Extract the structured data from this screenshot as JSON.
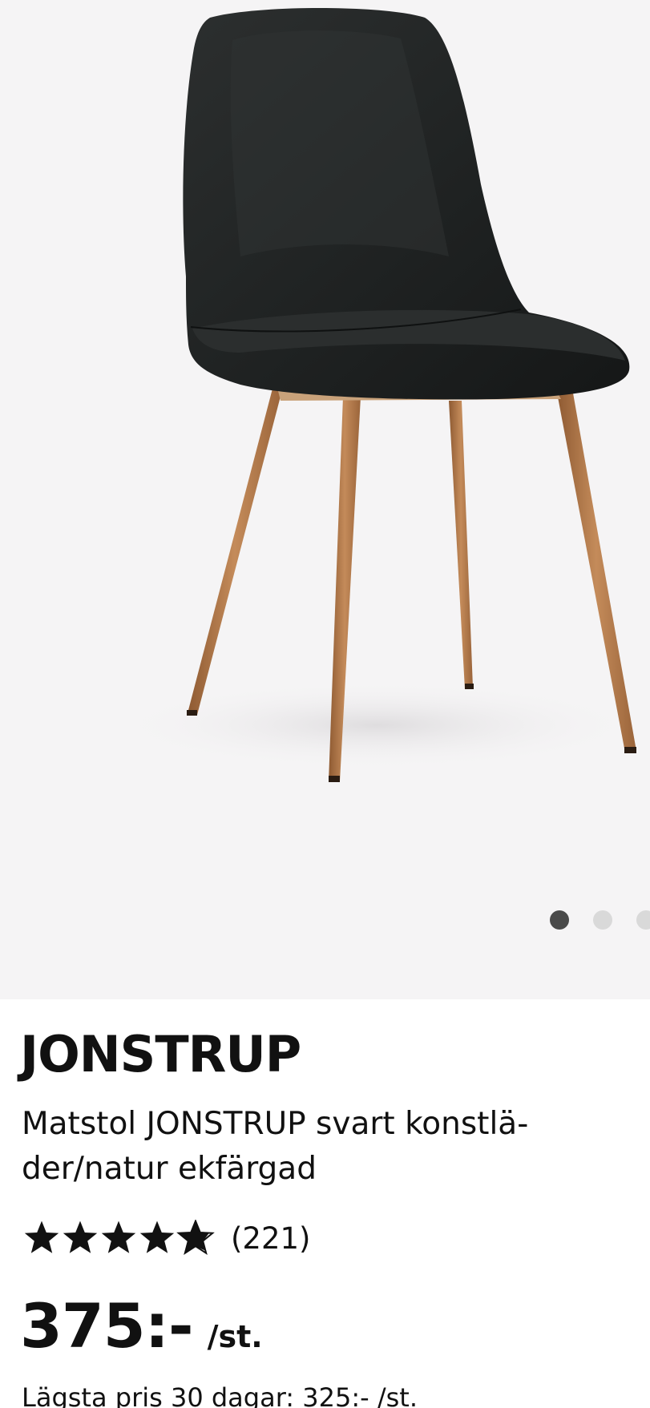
{
  "gallery": {
    "image_alt": "Matstol JONSTRUP svart konstläder/natur ekfärgad",
    "dots_count": 3,
    "active_dot": 0
  },
  "product": {
    "brand": "JONSTRUP",
    "description": "Matstol JONSTRUP svart konstlä- der/natur ekfärgad",
    "rating": {
      "stars": 5,
      "count_label": "(221)"
    },
    "price": {
      "amount": "375:-",
      "unit": "/st."
    },
    "lowest_price_label": "Lägsta pris 30 dagar: 325:- /st."
  },
  "colors": {
    "gallery_bg": "#f5f4f5",
    "text": "#111111",
    "dot_active": "#4a4a4a",
    "dot_inactive": "#d9d9d9",
    "seat": "#1f2121",
    "legs": "#b0784a"
  }
}
